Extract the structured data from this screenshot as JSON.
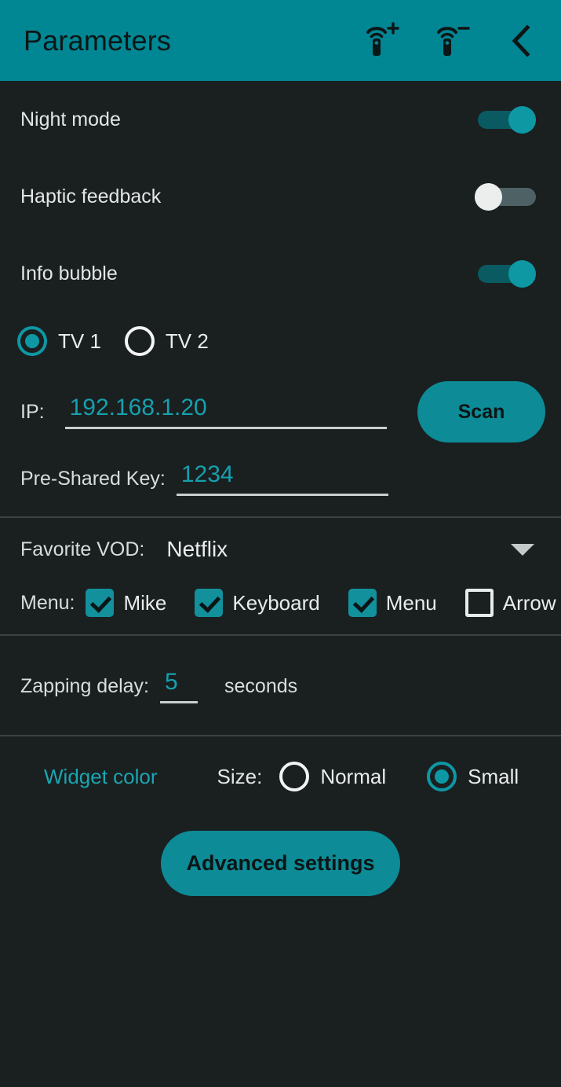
{
  "header": {
    "title": "Parameters",
    "add_remote_icon": "remote-add-icon",
    "remove_remote_icon": "remote-remove-icon",
    "back_icon": "chevron-left-icon",
    "add_superscript": "+",
    "remove_superscript": "−",
    "bar_color": "#008793"
  },
  "toggles": [
    {
      "label": "Night mode",
      "state": "on"
    },
    {
      "label": "Haptic feedback",
      "state": "off"
    },
    {
      "label": "Info bubble",
      "state": "on"
    }
  ],
  "tv_selector": {
    "options": [
      {
        "label": "TV 1",
        "selected": true
      },
      {
        "label": "TV 2",
        "selected": false
      }
    ]
  },
  "network": {
    "ip_label": "IP:",
    "ip_value": "192.168.1.20",
    "scan_label": "Scan",
    "psk_label": "Pre-Shared Key:",
    "psk_value": "1234"
  },
  "vod": {
    "label": "Favorite VOD:",
    "selected": "Netflix",
    "caret_icon": "chevron-down-icon"
  },
  "menu": {
    "label": "Menu:",
    "items": [
      {
        "label": "Mike",
        "checked": true
      },
      {
        "label": "Keyboard",
        "checked": true
      },
      {
        "label": "Menu",
        "checked": true
      },
      {
        "label": "Arrow",
        "checked": false
      }
    ]
  },
  "zapping": {
    "label": "Zapping delay:",
    "value": "5",
    "unit": "seconds"
  },
  "widget": {
    "color_link": "Widget color",
    "size_label": "Size:",
    "sizes": [
      {
        "label": "Normal",
        "selected": false
      },
      {
        "label": "Small",
        "selected": true
      }
    ],
    "advanced_label": "Advanced settings"
  },
  "colors": {
    "accent": "#0d8b96",
    "accent_bright": "#16a0ad",
    "background": "#1a1f20",
    "text": "#e9ecec"
  }
}
